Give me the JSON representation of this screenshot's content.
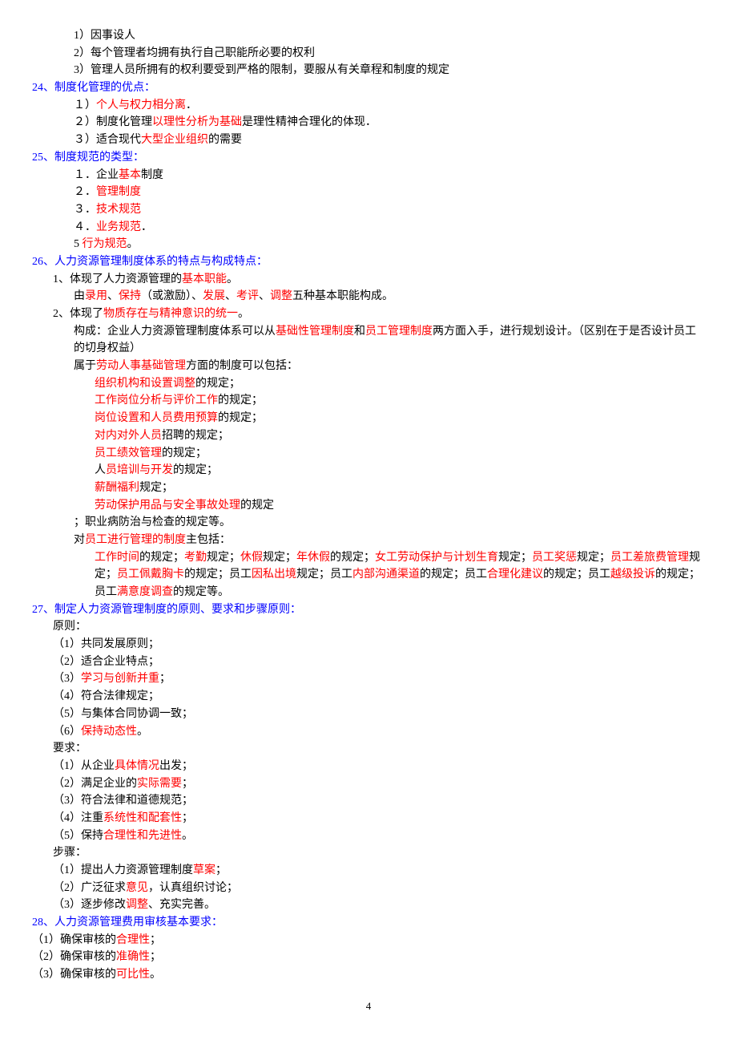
{
  "top": {
    "t1": "1）因事设人",
    "t2": "2）每个管理者均拥有执行自己职能所必要的权利",
    "t3": "3）管理人员所拥有的权利要受到严格的限制，要服从有关章程和制度的规定"
  },
  "s24": {
    "head": "24、制度化管理的优点：",
    "i1a": "１）",
    "i1b": "个人与权力相分离",
    "i1c": "．",
    "i2a": "２）制度化管理",
    "i2b": "以理性分析为基础",
    "i2c": "是理性精神合理化的体现．",
    "i3a": "３）适合现代",
    "i3b": "大型企业组织",
    "i3c": "的需要"
  },
  "s25": {
    "head": "25、制度规范的类型：",
    "i1a": "１．企业",
    "i1b": "基本",
    "i1c": "制度",
    "i2a": "２．",
    "i2b": "管理制度",
    "i3a": "３．",
    "i3b": "技术规范",
    "i4a": "４．",
    "i4b": "业务规范",
    "i4c": "．",
    "i5a": "5 ",
    "i5b": "行为规范",
    "i5c": "。"
  },
  "s26": {
    "head": "26、人力资源管理制度体系的特点与构成特点：",
    "p1a": "1、体现了人力资源管理的",
    "p1b": "基本职能",
    "p1c": "。",
    "p1da": "由",
    "p1db": "录用",
    "p1dc": "、",
    "p1dd": "保持",
    "p1de": "（或激励）、",
    "p1df": "发展",
    "p1dg": "、",
    "p1dh": "考评",
    "p1di": "、",
    "p1dj": "调整",
    "p1dk": "五种基本职能构成。",
    "p2a": "2、体现了",
    "p2b": "物质存在与精神意识的统一",
    "p2c": "。",
    "p2da": "构成：企业人力资源管理制度体系可以从",
    "p2db": "基础性管理制度",
    "p2dc": "和",
    "p2dd": "员工管理制度",
    "p2de": "两方面入手，进行规划设计。（区别在于是否设计员工的切身权益）",
    "p2ea": "属于",
    "p2eb": "劳动人事基础管理",
    "p2ec": "方面的制度可以包括：",
    "b1a": "组织机构和设置调整",
    "b1b": "的规定；",
    "b2a": "工作岗位分析与评价工作",
    "b2b": "的规定；",
    "b3a": "岗位设置和人员费用预算",
    "b3b": "的规定；",
    "b4a": "对内对外人员",
    "b4b": "招聘的规定；",
    "b5a": "员工绩效管理",
    "b5b": "的规定；",
    "b6a": "人",
    "b6b": "员培训与开发",
    "b6c": "的规定；",
    "b7a": "薪酬福利",
    "b7b": "规定；",
    "b8a": "劳动保护用品与安全事故处理",
    "b8b": "的规定",
    "b9a": "；职业病防治与检查的规定等。",
    "p2fa": "对",
    "p2fb": "员工进行管理的制度",
    "p2fc": "主包括：",
    "c1": "工作时间",
    "c2": "的规定；",
    "c3": "考勤",
    "c4": "规定；",
    "c5": "休假",
    "c6": "规定；",
    "c7": "年休假",
    "c8": "的规定；",
    "c9": "女工劳动保护与计划生育",
    "c10": "规定；",
    "c11": "员工奖惩",
    "c12": "规定；",
    "c13": "员工差旅费管理",
    "c14": "规定；",
    "c15": "员工佩戴胸卡",
    "c16": "的规定；员工",
    "c17": "因私出境",
    "c18": "规定；员工",
    "c19": "内部沟通渠道",
    "c20": "的规定；员工",
    "c21": "合理化建议",
    "c22": "的规定；员工",
    "c23": "越级投诉",
    "c24": "的规定；员工",
    "c25": "满意度调查",
    "c26": "的规定等。"
  },
  "s27": {
    "head": "27、制定人力资源管理制度的原则、要求和步骤原则：",
    "yz": "原则：",
    "y1": "（1）共同发展原则；",
    "y2": "（2）适合企业特点；",
    "y3a": "（3）",
    "y3b": "学习与创新并重",
    "y3c": "；",
    "y4": "（4）符合法律规定；",
    "y5": "（5）与集体合同协调一致；",
    "y6a": "（6）",
    "y6b": "保持动态性",
    "y6c": "。",
    "rq": "要求：",
    "r1a": "（1）从企业",
    "r1b": "具体情况",
    "r1c": "出发；",
    "r2a": "（2）满足企业的",
    "r2b": "实际需要",
    "r2c": "；",
    "r3": "（3）符合法律和道德规范；",
    "r4a": "（4）注重",
    "r4b": "系统性和配套性",
    "r4c": "；",
    "r5a": "（5）保持",
    "r5b": "合理性和先进性",
    "r5c": "。",
    "bz": "步骤：",
    "s1a": "（1）提出人力资源管理制度",
    "s1b": "草案",
    "s1c": "；",
    "s2a": "（2）广泛征求",
    "s2b": "意见",
    "s2c": "，认真组织讨论；",
    "s3a": "（3）逐步修改",
    "s3b": "调整",
    "s3c": "、充实完善。"
  },
  "s28": {
    "head": "28、人力资源管理费用审核基本要求：",
    "i1a": "（1）确保审核的",
    "i1b": "合理性",
    "i1c": "；",
    "i2a": "（2）确保审核的",
    "i2b": "准确性",
    "i2c": "；",
    "i3a": "（3）确保审核的",
    "i3b": "可比性",
    "i3c": "。"
  },
  "page": "4"
}
